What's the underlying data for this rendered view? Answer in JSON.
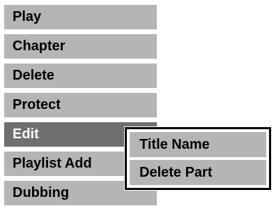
{
  "menu": {
    "items": [
      {
        "label": "Play"
      },
      {
        "label": "Chapter"
      },
      {
        "label": "Delete"
      },
      {
        "label": "Protect"
      },
      {
        "label": "Edit",
        "selected": true
      },
      {
        "label": "Playlist Add"
      },
      {
        "label": "Dubbing"
      }
    ]
  },
  "submenu": {
    "items": [
      {
        "label": "Title Name"
      },
      {
        "label": "Delete Part"
      }
    ]
  },
  "colors": {
    "item_bg": "#b5b5b5",
    "selected_bg": "#6f6f6f",
    "selected_text": "#ffffff",
    "submenu_border": "#000000"
  }
}
